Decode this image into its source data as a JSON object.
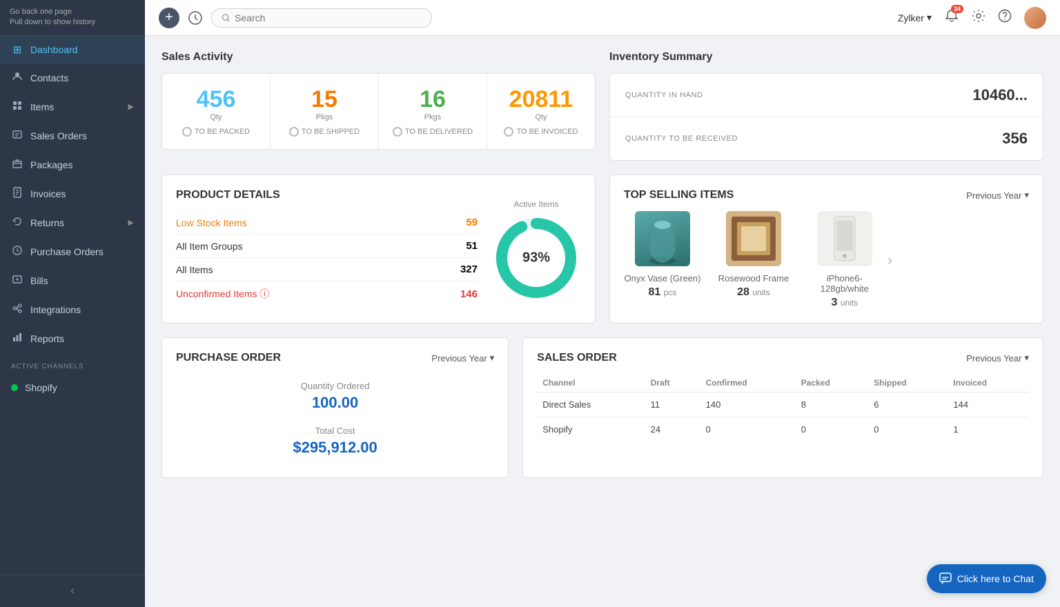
{
  "sidebar": {
    "back_label": "Go back one page\nPull down to show history",
    "items": [
      {
        "id": "dashboard",
        "label": "Dashboard",
        "icon": "⊞",
        "active": true
      },
      {
        "id": "contacts",
        "label": "Contacts",
        "icon": "👤",
        "active": false
      },
      {
        "id": "items",
        "label": "Items",
        "icon": "📦",
        "active": false,
        "arrow": "▶"
      },
      {
        "id": "sales-orders",
        "label": "Sales Orders",
        "icon": "🛒",
        "active": false
      },
      {
        "id": "packages",
        "label": "Packages",
        "icon": "📫",
        "active": false
      },
      {
        "id": "invoices",
        "label": "Invoices",
        "icon": "📄",
        "active": false
      },
      {
        "id": "returns",
        "label": "Returns",
        "icon": "↩",
        "active": false,
        "arrow": "▶"
      },
      {
        "id": "purchase-orders",
        "label": "Purchase Orders",
        "icon": "🏷",
        "active": false
      },
      {
        "id": "bills",
        "label": "Bills",
        "icon": "💵",
        "active": false
      },
      {
        "id": "integrations",
        "label": "Integrations",
        "icon": "🔗",
        "active": false
      },
      {
        "id": "reports",
        "label": "Reports",
        "icon": "📊",
        "active": false
      }
    ],
    "active_channels_label": "ACTIVE CHANNELS",
    "shopify_label": "Shopify"
  },
  "topbar": {
    "search_placeholder": "Search",
    "username": "Zylker",
    "notif_count": "34",
    "add_label": "+",
    "history_icon": "🕐"
  },
  "sales_activity": {
    "title": "Sales Activity",
    "cards": [
      {
        "value": "456",
        "unit": "Qty",
        "status": "TO BE PACKED",
        "color": "#4fc3f7"
      },
      {
        "value": "15",
        "unit": "Pkgs",
        "status": "TO BE SHIPPED",
        "color": "#f57c00"
      },
      {
        "value": "16",
        "unit": "Pkgs",
        "status": "TO BE DELIVERED",
        "color": "#4caf50"
      },
      {
        "value": "20811",
        "unit": "Qty",
        "status": "TO BE INVOICED",
        "color": "#ff9800"
      }
    ]
  },
  "inventory_summary": {
    "title": "Inventory Summary",
    "rows": [
      {
        "label": "QUANTITY IN HAND",
        "value": "10460..."
      },
      {
        "label": "QUANTITY TO BE RECEIVED",
        "value": "356"
      }
    ]
  },
  "product_details": {
    "title": "PRODUCT DETAILS",
    "rows": [
      {
        "label": "Low Stock Items",
        "value": "59",
        "style": "orange"
      },
      {
        "label": "All Item Groups",
        "value": "51",
        "style": "normal"
      },
      {
        "label": "All Items",
        "value": "327",
        "style": "bold"
      },
      {
        "label": "Unconfirmed Items",
        "value": "146",
        "style": "red"
      }
    ],
    "donut": {
      "label": "Active Items",
      "percent": 93,
      "display": "93%",
      "color": "#26c6a6",
      "bg_color": "#e0f7f1"
    }
  },
  "top_selling": {
    "title": "TOP SELLING ITEMS",
    "period": "Previous Year",
    "items": [
      {
        "name": "Onyx Vase (Green)",
        "count": "81",
        "unit": "pcs",
        "img_type": "vase"
      },
      {
        "name": "Rosewood Frame",
        "count": "28",
        "unit": "units",
        "img_type": "frame"
      },
      {
        "name": "iPhone6-128gb/white",
        "count": "3",
        "unit": "units",
        "img_type": "phone"
      }
    ]
  },
  "purchase_order": {
    "title": "PURCHASE ORDER",
    "period": "Previous Year",
    "stats": [
      {
        "label": "Quantity Ordered",
        "value": "100.00",
        "type": "number"
      },
      {
        "label": "Total Cost",
        "value": "$295,912.00",
        "type": "currency"
      }
    ]
  },
  "sales_order": {
    "title": "SALES ORDER",
    "period": "Previous Year",
    "columns": [
      "Channel",
      "Draft",
      "Confirmed",
      "Packed",
      "Shipped",
      "Invoiced"
    ],
    "rows": [
      {
        "channel": "Direct Sales",
        "draft": "11",
        "confirmed": "140",
        "packed": "8",
        "shipped": "6",
        "invoiced": "144"
      },
      {
        "channel": "Shopify",
        "draft": "24",
        "confirmed": "0",
        "packed": "0",
        "shipped": "0",
        "invoiced": "1"
      }
    ]
  },
  "chat": {
    "label": "Click here to Chat",
    "icon": "💬"
  }
}
